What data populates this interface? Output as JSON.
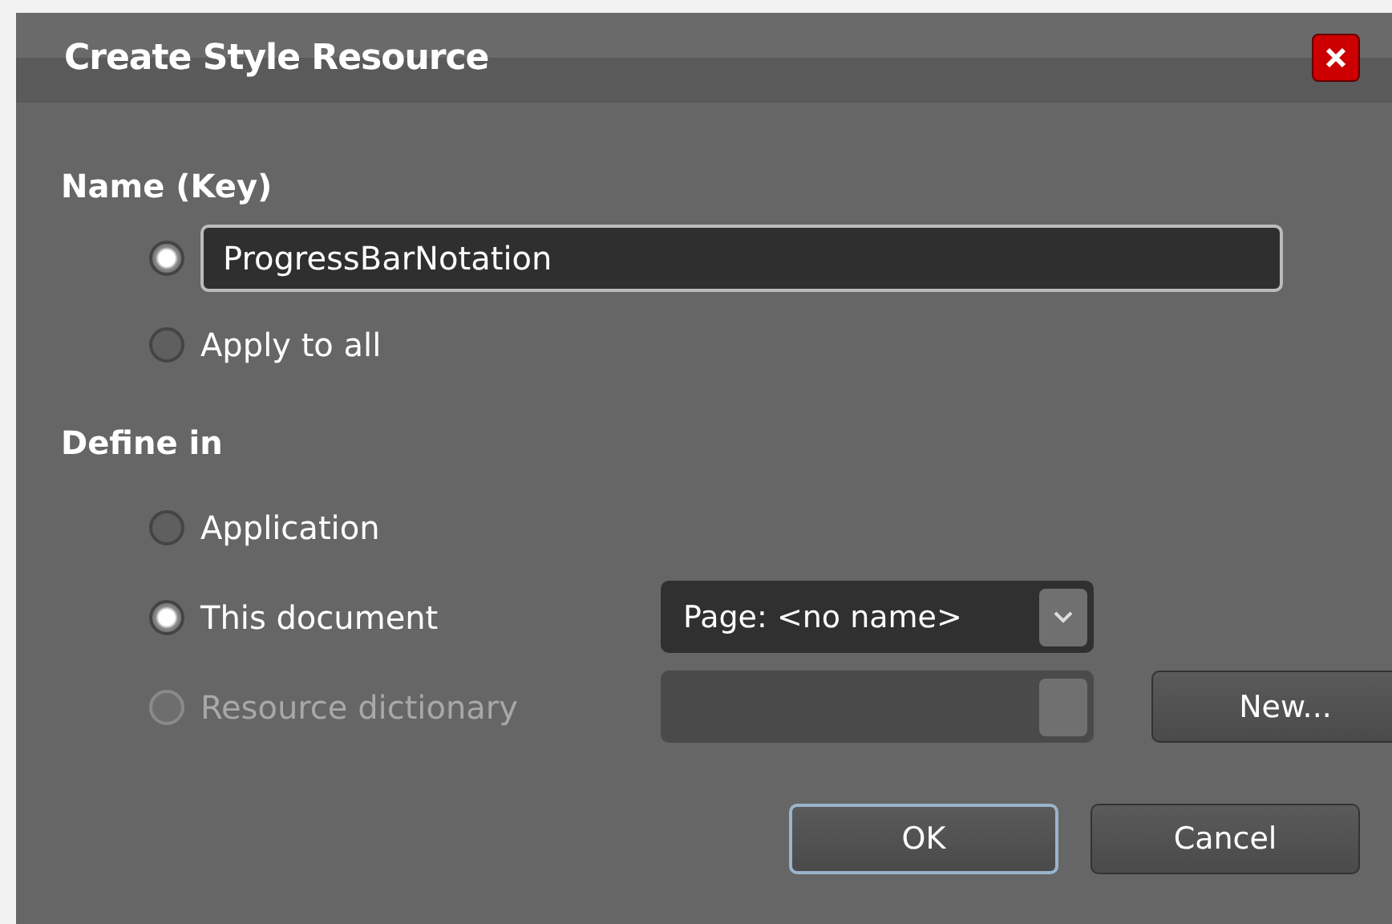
{
  "window": {
    "title": "Create Style Resource"
  },
  "name_section": {
    "label": "Name (Key)",
    "options": [
      {
        "kind": "field",
        "selected": true,
        "value": "ProgressBarNotation"
      },
      {
        "kind": "label",
        "selected": false,
        "label": "Apply to all"
      }
    ]
  },
  "define_section": {
    "label": "Define in",
    "options": [
      {
        "label": "Application",
        "selected": false,
        "disabled": false
      },
      {
        "label": "This document",
        "selected": true,
        "disabled": false,
        "dropdown": {
          "value": "Page: <no name>",
          "disabled": false
        }
      },
      {
        "label": "Resource dictionary",
        "selected": false,
        "disabled": true,
        "dropdown": {
          "disabled": true
        },
        "button": "New..."
      }
    ]
  },
  "buttons": [
    {
      "label": "OK",
      "default": true
    },
    {
      "label": "Cancel",
      "default": false
    }
  ]
}
